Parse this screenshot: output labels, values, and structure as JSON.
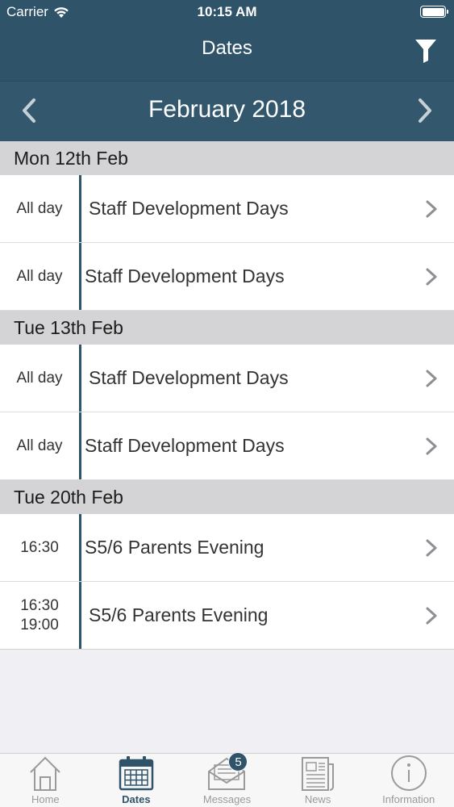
{
  "status": {
    "carrier": "Carrier",
    "time": "10:15 AM"
  },
  "nav": {
    "title": "Dates"
  },
  "month": {
    "label": "February 2018"
  },
  "days": [
    {
      "header": "Mon 12th Feb",
      "events": [
        {
          "time": "All day",
          "time2": "",
          "title": "Staff Development Days"
        },
        {
          "time": "All day",
          "time2": "",
          "title": "Staff Development Days"
        }
      ]
    },
    {
      "header": "Tue 13th Feb",
      "events": [
        {
          "time": "All day",
          "time2": "",
          "title": "Staff Development Days"
        },
        {
          "time": "All day",
          "time2": "",
          "title": "Staff Development Days"
        }
      ]
    },
    {
      "header": "Tue 20th Feb",
      "events": [
        {
          "time": "16:30",
          "time2": "",
          "title": "S5/6 Parents Evening"
        },
        {
          "time": "16:30",
          "time2": "19:00",
          "title": "S5/6 Parents Evening"
        }
      ]
    }
  ],
  "tabs": {
    "home": "Home",
    "dates": "Dates",
    "messages": "Messages",
    "messages_badge": "5",
    "news": "News",
    "information": "Information"
  },
  "colors": {
    "header": "#2f5368",
    "accent": "#2f5368",
    "day_header_bg": "#d4d4d6"
  }
}
